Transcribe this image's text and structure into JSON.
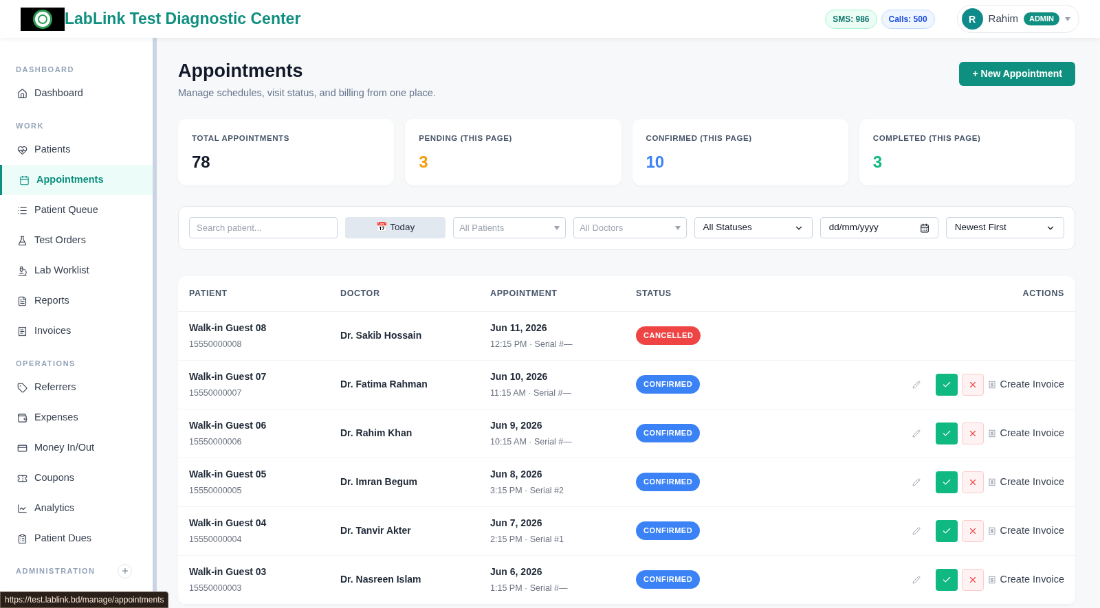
{
  "header": {
    "brand": "LabLink Test Diagnostic Center",
    "sms": "SMS: 986",
    "calls": "Calls: 500",
    "user": {
      "initial": "R",
      "name": "Rahim",
      "role": "ADMIN"
    }
  },
  "sidebar": {
    "sections": [
      {
        "title": "DASHBOARD",
        "kind": "group",
        "items": [
          {
            "label": "Dashboard",
            "selected": false
          }
        ]
      },
      {
        "title": "WORK",
        "kind": "group",
        "items": [
          {
            "label": "Patients",
            "selected": false
          },
          {
            "label": "Appointments",
            "selected": true
          },
          {
            "label": "Patient Queue",
            "selected": false
          },
          {
            "label": "Test Orders",
            "selected": false
          },
          {
            "label": "Lab Worklist",
            "selected": false
          },
          {
            "label": "Reports",
            "selected": false
          },
          {
            "label": "Invoices",
            "selected": false
          }
        ]
      },
      {
        "title": "OPERATIONS",
        "kind": "group",
        "items": [
          {
            "label": "Referrers",
            "selected": false
          },
          {
            "label": "Expenses",
            "selected": false
          },
          {
            "label": "Money In/Out",
            "selected": false
          },
          {
            "label": "Coupons",
            "selected": false
          },
          {
            "label": "Analytics",
            "selected": false
          },
          {
            "label": "Patient Dues",
            "selected": false
          }
        ]
      },
      {
        "title": "ADMINISTRATION",
        "kind": "collapsible"
      }
    ]
  },
  "page": {
    "title": "Appointments",
    "subtitle": "Manage schedules, visit status, and billing from one place.",
    "new_button": "+ New Appointment"
  },
  "stats": [
    {
      "label": "TOTAL APPOINTMENTS",
      "value": "78",
      "color": "#111827"
    },
    {
      "label": "PENDING (THIS PAGE)",
      "value": "3",
      "color": "#f59e0b"
    },
    {
      "label": "CONFIRMED (THIS PAGE)",
      "value": "10",
      "color": "#3b82f6"
    },
    {
      "label": "COMPLETED (THIS PAGE)",
      "value": "3",
      "color": "#10b981"
    }
  ],
  "filters": {
    "search_placeholder": "Search patient...",
    "today": "📅 Today",
    "patients": "All Patients",
    "doctors": "All Doctors",
    "status": "All Statuses",
    "date": "dd/mm/yyyy",
    "sort": "Newest First"
  },
  "table": {
    "columns": [
      "PATIENT",
      "DOCTOR",
      "APPOINTMENT",
      "STATUS",
      "ACTIONS"
    ],
    "rows": [
      {
        "patient": "Walk-in Guest 08",
        "phone": "15550000008",
        "doctor": "Dr. Sakib Hossain",
        "date": "Jun 11, 2026",
        "time": "12:15 PM · Serial #—",
        "status": "CANCELLED",
        "color": "#ef4444"
      },
      {
        "patient": "Walk-in Guest 07",
        "phone": "15550000007",
        "doctor": "Dr. Fatima Rahman",
        "date": "Jun 10, 2026",
        "time": "11:15 AM · Serial #—",
        "status": "CONFIRMED",
        "color": "#3b82f6",
        "invoice": "Create Invoice"
      },
      {
        "patient": "Walk-in Guest 06",
        "phone": "15550000006",
        "doctor": "Dr. Rahim Khan",
        "date": "Jun 9, 2026",
        "time": "10:15 AM · Serial #—",
        "status": "CONFIRMED",
        "color": "#3b82f6",
        "invoice": "Create Invoice"
      },
      {
        "patient": "Walk-in Guest 05",
        "phone": "15550000005",
        "doctor": "Dr. Imran Begum",
        "date": "Jun 8, 2026",
        "time": "3:15 PM · Serial #2",
        "status": "CONFIRMED",
        "color": "#3b82f6",
        "invoice": "Create Invoice"
      },
      {
        "patient": "Walk-in Guest 04",
        "phone": "15550000004",
        "doctor": "Dr. Tanvir Akter",
        "date": "Jun 7, 2026",
        "time": "2:15 PM · Serial #1",
        "status": "CONFIRMED",
        "color": "#3b82f6",
        "invoice": "Create Invoice"
      },
      {
        "patient": "Walk-in Guest 03",
        "phone": "15550000003",
        "doctor": "Dr. Nasreen Islam",
        "date": "Jun 6, 2026",
        "time": "1:15 PM · Serial #—",
        "status": "CONFIRMED",
        "color": "#3b82f6",
        "invoice": "Create Invoice"
      }
    ]
  },
  "status_bar": {
    "url": "https://test.lablink.bd/manage/appointments"
  }
}
